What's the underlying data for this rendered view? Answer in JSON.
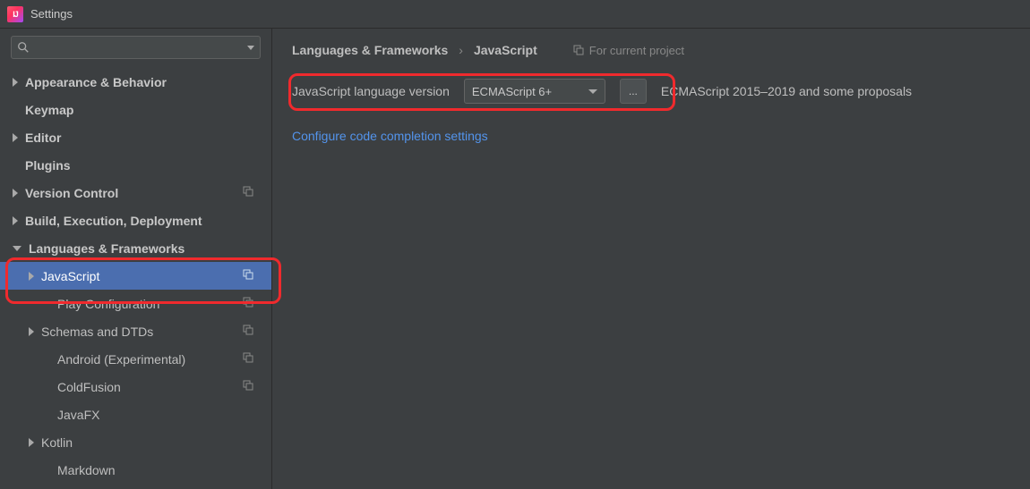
{
  "window": {
    "title": "Settings"
  },
  "sidebar": {
    "search_placeholder": "",
    "items": [
      {
        "label": "Appearance & Behavior",
        "bold": true,
        "arrow": "right",
        "indent": 0
      },
      {
        "label": "Keymap",
        "bold": true,
        "arrow": "none",
        "indent": 0
      },
      {
        "label": "Editor",
        "bold": true,
        "arrow": "right",
        "indent": 0
      },
      {
        "label": "Plugins",
        "bold": true,
        "arrow": "none",
        "indent": 0
      },
      {
        "label": "Version Control",
        "bold": true,
        "arrow": "right",
        "indent": 0,
        "proj": true
      },
      {
        "label": "Build, Execution, Deployment",
        "bold": true,
        "arrow": "right",
        "indent": 0
      },
      {
        "label": "Languages & Frameworks",
        "bold": true,
        "arrow": "down",
        "indent": 0
      },
      {
        "label": "JavaScript",
        "bold": false,
        "arrow": "right",
        "indent": 1,
        "selected": true,
        "proj": true
      },
      {
        "label": "Play Configuration",
        "bold": false,
        "arrow": "none",
        "indent": 2,
        "proj": true
      },
      {
        "label": "Schemas and DTDs",
        "bold": false,
        "arrow": "right",
        "indent": 1,
        "proj": true
      },
      {
        "label": "Android (Experimental)",
        "bold": false,
        "arrow": "none",
        "indent": 2,
        "proj": true
      },
      {
        "label": "ColdFusion",
        "bold": false,
        "arrow": "none",
        "indent": 2,
        "proj": true
      },
      {
        "label": "JavaFX",
        "bold": false,
        "arrow": "none",
        "indent": 2
      },
      {
        "label": "Kotlin",
        "bold": false,
        "arrow": "right",
        "indent": 1
      },
      {
        "label": "Markdown",
        "bold": false,
        "arrow": "none",
        "indent": 2
      }
    ]
  },
  "breadcrumb": {
    "a": "Languages & Frameworks",
    "b": "JavaScript",
    "badge": "For current project"
  },
  "panel": {
    "label": "JavaScript language version",
    "combo_value": "ECMAScript 6+",
    "dots": "...",
    "desc": "ECMAScript 2015–2019 and some proposals",
    "link": "Configure code completion settings"
  }
}
